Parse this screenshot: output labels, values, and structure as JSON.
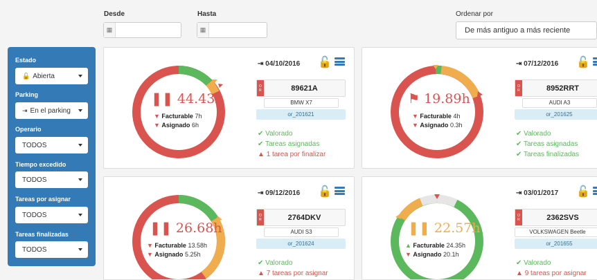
{
  "filters": {
    "desde_label": "Desde",
    "hasta_label": "Hasta",
    "ordenar_label": "Ordenar por",
    "ordenar_value": "De más antiguo a más reciente"
  },
  "sidebar": {
    "estado_label": "Estado",
    "estado_value": "Abierta",
    "parking_label": "Parking",
    "parking_value": "En el parking",
    "operario_label": "Operario",
    "operario_value": "TODOS",
    "tiempo_label": "Tiempo excedido",
    "tiempo_value": "TODOS",
    "tareas_asignar_label": "Tareas por asignar",
    "tareas_asignar_value": "TODOS",
    "tareas_finalizadas_label": "Tareas finalizadas",
    "tareas_finalizadas_value": "TODOS"
  },
  "colors": {
    "red": "#d9534f",
    "green": "#5cb85c",
    "orange": "#f0ad4e",
    "blue": "#337ab7"
  },
  "cards": [
    {
      "date": "04/10/2016",
      "hours": "44.43h",
      "hours_color": "#d9534f",
      "facturable_label": "Facturable",
      "facturable_value": "7h",
      "asignado_label": "Asignado",
      "asignado_value": "6h",
      "plate": "89621A",
      "model": "BMW X7",
      "order": "or_201621",
      "status": [
        {
          "icon": "check",
          "text": "Valorado"
        },
        {
          "icon": "check",
          "text": "Tareas asignadas"
        },
        {
          "icon": "warning",
          "text": "1 tarea por finalizar"
        }
      ]
    },
    {
      "date": "07/12/2016",
      "hours": "19.89h",
      "hours_color": "#d9534f",
      "facturable_label": "Facturable",
      "facturable_value": "4h",
      "asignado_label": "Asignado",
      "asignado_value": "0.3h",
      "plate": "8952RRT",
      "model": "AUDI A3",
      "order": "or_201625",
      "status": [
        {
          "icon": "check",
          "text": "Valorado"
        },
        {
          "icon": "check",
          "text": "Tareas asignadas"
        },
        {
          "icon": "check",
          "text": "Tareas finalizadas"
        }
      ]
    },
    {
      "date": "09/12/2016",
      "hours": "26.68h",
      "hours_color": "#d9534f",
      "facturable_label": "Facturable",
      "facturable_value": "13.58h",
      "asignado_label": "Asignado",
      "asignado_value": "5.25h",
      "plate": "2764DKV",
      "model": "AUDI S3",
      "order": "or_201624",
      "status": [
        {
          "icon": "check",
          "text": "Valorado"
        },
        {
          "icon": "warning",
          "text": "7 tareas por asignar"
        }
      ]
    },
    {
      "date": "03/01/2017",
      "hours": "22.57h",
      "hours_color": "#f0ad4e",
      "facturable_label": "Facturable",
      "facturable_value": "24.35h",
      "asignado_label": "Asignado",
      "asignado_value": "20.1h",
      "plate": "2362SVS",
      "model": "VOLKSWAGEN Beetle",
      "order": "or_201655",
      "status": [
        {
          "icon": "check",
          "text": "Valorado"
        },
        {
          "icon": "warning",
          "text": "9 tareas por asignar"
        }
      ]
    }
  ]
}
